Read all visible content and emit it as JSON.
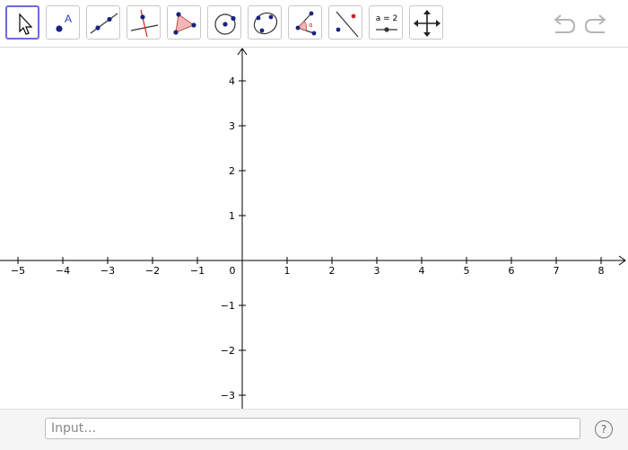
{
  "toolbar": {
    "tools": [
      {
        "name": "move-tool",
        "icon": "cursor-arrow-icon",
        "active": true
      },
      {
        "name": "point-tool",
        "icon": "point-with-label-icon",
        "label": "A"
      },
      {
        "name": "line-tool",
        "icon": "line-through-two-points-icon"
      },
      {
        "name": "perpendicular-line-tool",
        "icon": "perpendicular-line-icon"
      },
      {
        "name": "polygon-tool",
        "icon": "polygon-triangle-icon"
      },
      {
        "name": "circle-center-point-tool",
        "icon": "circle-center-point-icon"
      },
      {
        "name": "conic-five-points-tool",
        "icon": "ellipse-through-points-icon"
      },
      {
        "name": "angle-tool",
        "icon": "angle-icon",
        "label": "α"
      },
      {
        "name": "reflect-tool",
        "icon": "reflect-about-line-icon"
      },
      {
        "name": "slider-tool",
        "icon": "slider-icon",
        "label": "a = 2"
      },
      {
        "name": "move-graphics-view-tool",
        "icon": "move-arrows-icon"
      }
    ],
    "undo_icon": "undo-icon",
    "redo_icon": "redo-icon"
  },
  "graphics": {
    "x_range": [
      -5.3,
      8.6
    ],
    "y_range": [
      -3.3,
      4.7
    ],
    "x_ticks": [
      "−5",
      "−4",
      "−3",
      "−2",
      "−1",
      "0",
      "1",
      "2",
      "3",
      "4",
      "5",
      "6",
      "7",
      "8"
    ],
    "y_ticks_positive": [
      "1",
      "2",
      "3",
      "4"
    ],
    "y_ticks_negative": [
      "−1",
      "−2",
      "−3"
    ],
    "origin_label": "0",
    "axis_color": "#000000",
    "grid": false
  },
  "input_bar": {
    "placeholder": "Input…",
    "help_label": "?"
  },
  "colors": {
    "point": "#1a237e",
    "polygon_fill": "#f3b6b6",
    "accent": "#6b6bd8",
    "toolbar_border": "#c8c8c8",
    "line_red": "#c62828"
  }
}
